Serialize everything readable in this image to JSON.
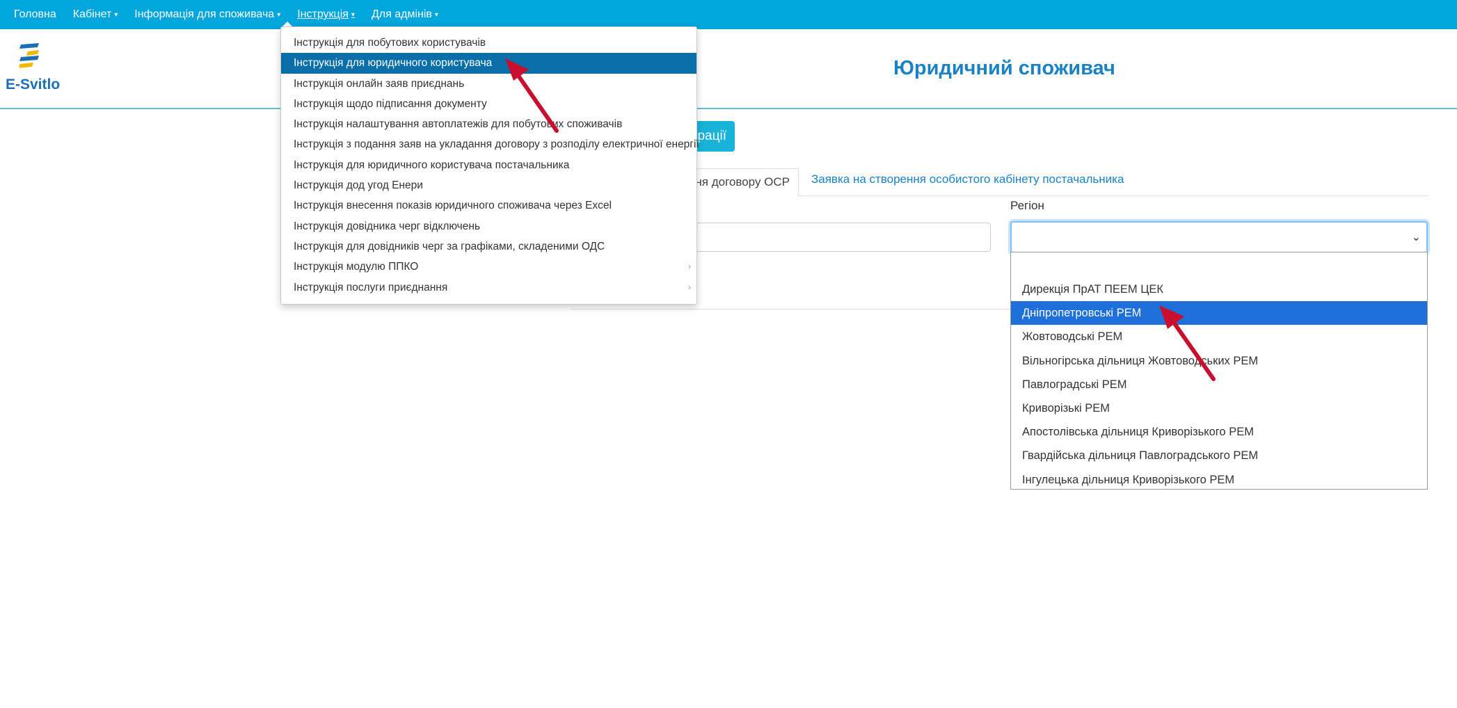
{
  "nav": {
    "items": [
      {
        "label": "Головна",
        "has_caret": false
      },
      {
        "label": "Кабінет",
        "has_caret": true
      },
      {
        "label": "Інформація для споживача",
        "has_caret": true
      },
      {
        "label": "Інструкція",
        "has_caret": true
      },
      {
        "label": "Для адмінів",
        "has_caret": true
      }
    ],
    "caret_glyph": "▾"
  },
  "header": {
    "logo_text": "E-Svitlo",
    "page_title": "Юридичний споживач"
  },
  "main": {
    "register_button_partial": "рації",
    "tab_active_partial": "ня договору ОСР",
    "tab_link": "Заявка на створення особистого кабінету постачальника",
    "region_label": "Регіон",
    "select_arrow": "⌄"
  },
  "instructions_menu": {
    "items": [
      {
        "label": "Інструкція для побутових користувачів"
      },
      {
        "label": "Інструкція для юридичного користувача"
      },
      {
        "label": "Інструкція онлайн заяв приєднань"
      },
      {
        "label": "Інструкція щодо підписання документу"
      },
      {
        "label": "Інструкція налаштування автоплатежів для побутових споживачів"
      },
      {
        "label": "Інструкція з подання заяв на укладання договору з розподілу електричної енергії"
      },
      {
        "label": "Інструкція для юридичного користувача постачальника"
      },
      {
        "label": "Інструкція дод угод Енери"
      },
      {
        "label": "Інструкція внесення показів юридичного споживача через Excel"
      },
      {
        "label": "Інструкція довідника черг відключень"
      },
      {
        "label": "Інструкція для довідників черг за графіками, складеними ОДС"
      },
      {
        "label": "Інструкція модулю ППКО"
      },
      {
        "label": "Інструкція послуги приєднання"
      }
    ],
    "highlighted_index": 1,
    "submenu_arrow": "›"
  },
  "region_options": {
    "items": [
      "Дирекція ПрАТ ПЕЕМ ЦЕК",
      "Дніпропетровські РЕМ",
      "Жовтоводські РЕМ",
      "Вільногірська дільниця Жовтоводських РЕМ",
      "Павлоградські РЕМ",
      "Криворізькі РЕМ",
      "Апостолівська дільниця Криворізького РЕМ",
      "Гвардійська дільниця Павлоградського РЕМ",
      "Інгулецька дільниця Криворізького РЕМ"
    ],
    "selected_index": 1
  },
  "colors": {
    "navbar": "#00a6dc",
    "menu_highlight": "#0a6fa8",
    "option_selected": "#1e6fd9",
    "title": "#1a82c4",
    "arrow": "#c8102e"
  }
}
